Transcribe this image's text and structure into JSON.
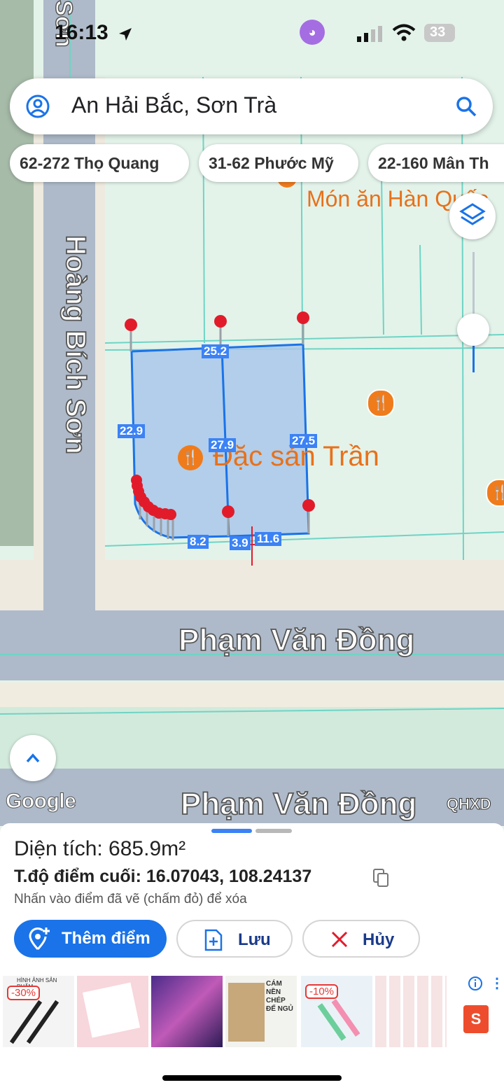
{
  "status_bar": {
    "time": "16:13",
    "battery": "33"
  },
  "search": {
    "query": "An Hải Bắc, Sơn Trà"
  },
  "chips": [
    "62-272 Thọ Quang",
    "31-62 Phước Mỹ",
    "22-160 Mân Th"
  ],
  "map": {
    "streets": {
      "left_vertical_top": "Sơn",
      "hoang_bich_son": "Hoàng Bích Sơn",
      "pham_van_dong_1": "Phạm Văn Đồng",
      "pham_van_dong_2": "Phạm Văn Đồng"
    },
    "places": {
      "restaurant_top": "Món ăn Hàn Quốc",
      "dac_san": "Đặc sản Trần"
    },
    "measurements": {
      "top": "25.2",
      "left": "22.9",
      "middle": "27.9",
      "right": "27.5",
      "bottom_left": "8.2",
      "bottom_mid": "3.9",
      "bottom_right": "11.6"
    },
    "branding": {
      "google": "Google",
      "layer_tag": "QHXD"
    }
  },
  "sheet": {
    "area_label": "Diện tích: 685.9m²",
    "coords_label": "T.độ điểm cuối: 16.07043, 108.24137",
    "hint": "Nhấn vào điểm đã vẽ (chấm đỏ) để xóa",
    "buttons": {
      "add_point": "Thêm điểm",
      "save": "Lưu",
      "cancel": "Hủy"
    }
  },
  "ads": {
    "items": [
      {
        "badge": "-30%",
        "caption": "HÌNH ẢNH SẢN PHẨM"
      },
      {
        "badge": "",
        "caption": ""
      },
      {
        "badge": "",
        "caption": ""
      },
      {
        "badge": "",
        "caption": "CÁM NỀN CHÉP ĐẾ NGỦ"
      },
      {
        "badge": "-10%",
        "caption": ""
      },
      {
        "badge": "",
        "caption": ""
      }
    ]
  },
  "colors": {
    "accent": "#1a73e8",
    "red": "#e21b2b",
    "parcel_fill": "#a9c7ea",
    "poi_orange": "#f07b1b"
  }
}
